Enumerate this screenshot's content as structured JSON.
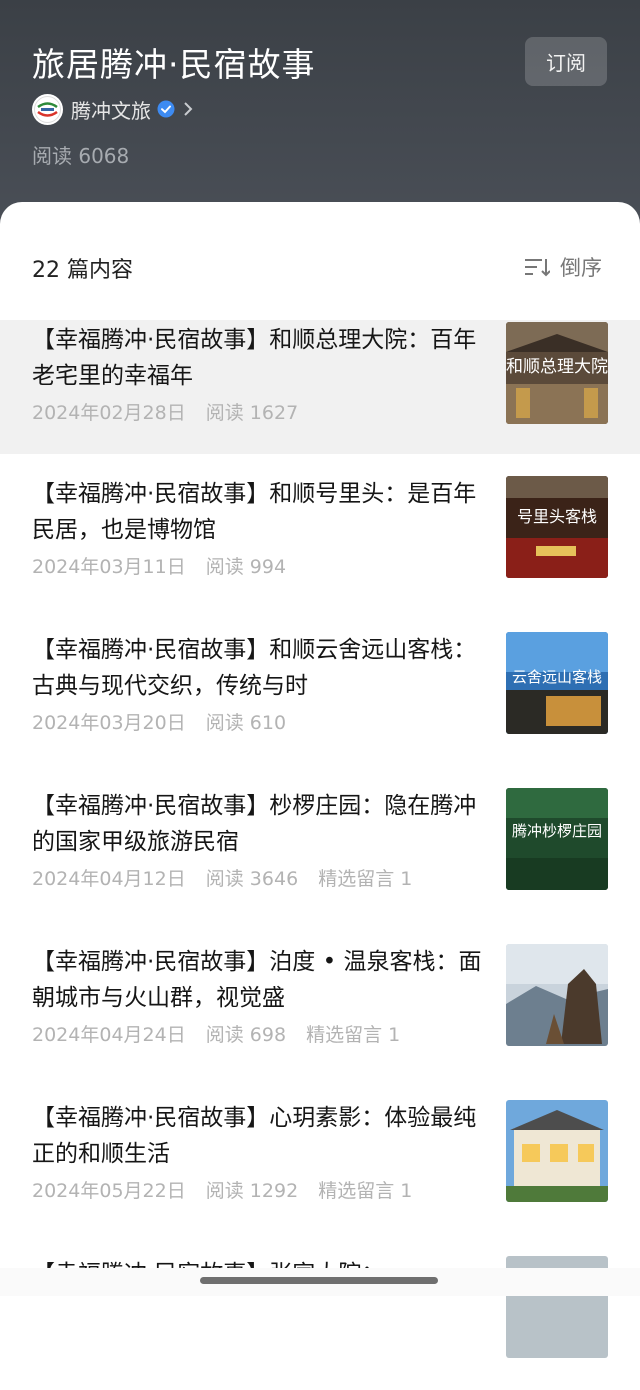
{
  "header": {
    "title": "旅居腾冲·民宿故事",
    "subscribe_label": "订阅",
    "account_name": "腾冲文旅",
    "read_count": "阅读 6068",
    "avatar_icon": "account-logo-icon",
    "verified_icon": "verified-check-icon"
  },
  "sheet": {
    "count_label": "22 篇内容",
    "sort_label": "倒序",
    "sort_icon": "sort-order-icon"
  },
  "articles": [
    {
      "title": "【幸福腾冲·民宿故事】和顺总理大院：百年老宅里的幸福年",
      "date": "2024年02月28日",
      "reads": "阅读 1627",
      "comments": "",
      "thumb_text": "和顺总理大院"
    },
    {
      "title": "【幸福腾冲·民宿故事】和顺号里头：是百年民居，也是博物馆",
      "date": "2024年03月11日",
      "reads": "阅读 994",
      "comments": "",
      "thumb_text": "号里头客栈"
    },
    {
      "title": "【幸福腾冲·民宿故事】和顺云舍远山客栈：古典与现代交织，传统与时",
      "date": "2024年03月20日",
      "reads": "阅读 610",
      "comments": "",
      "thumb_text": "云舍远山客栈"
    },
    {
      "title": "【幸福腾冲·民宿故事】杪椤庄园：隐在腾冲的国家甲级旅游民宿",
      "date": "2024年04月12日",
      "reads": "阅读 3646",
      "comments": "精选留言 1",
      "thumb_text": "腾冲杪椤庄园"
    },
    {
      "title": "【幸福腾冲·民宿故事】泊度 • 温泉客栈：面朝城市与火山群，视觉盛",
      "date": "2024年04月24日",
      "reads": "阅读 698",
      "comments": "精选留言 1",
      "thumb_text": ""
    },
    {
      "title": "【幸福腾冲·民宿故事】心玥素影：体验最纯正的和顺生活",
      "date": "2024年05月22日",
      "reads": "阅读 1292",
      "comments": "精选留言 1",
      "thumb_text": ""
    },
    {
      "title": "【幸福腾冲·民宿故事】张家大院：",
      "date": "",
      "reads": "",
      "comments": "",
      "thumb_text": ""
    }
  ]
}
